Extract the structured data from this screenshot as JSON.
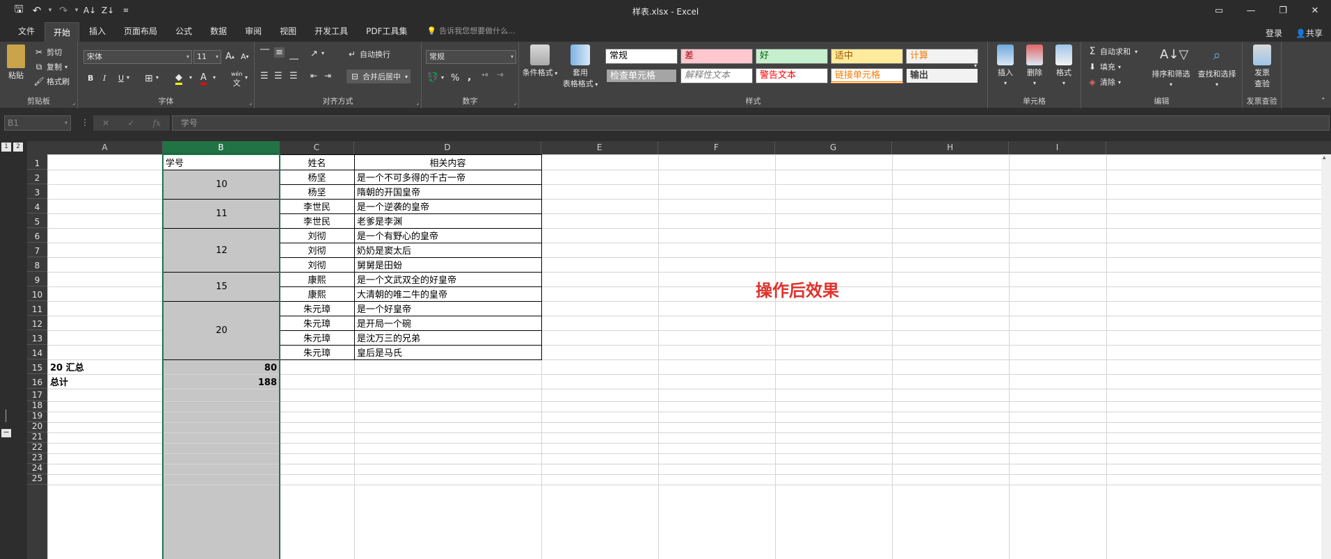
{
  "window": {
    "title": "样表.xlsx - Excel"
  },
  "qat": {
    "save_icon": "save-icon",
    "undo_icon": "undo-icon",
    "redo_icon": "redo-icon",
    "sort_asc_icon": "sort-asc-icon",
    "sort_desc_icon": "sort-desc-icon",
    "customize_icon": "customize-icon"
  },
  "tabs": [
    "文件",
    "开始",
    "插入",
    "页面布局",
    "公式",
    "数据",
    "审阅",
    "视图",
    "开发工具",
    "PDF工具集"
  ],
  "active_tab": "开始",
  "tellme": "告诉我您想要做什么...",
  "login": "登录",
  "share": "共享",
  "ribbon": {
    "clipboard": {
      "label": "剪贴板",
      "paste": "粘贴",
      "cut": "剪切",
      "copy": "复制",
      "format_painter": "格式刷"
    },
    "font": {
      "label": "字体",
      "name": "宋体",
      "size": "11",
      "grow": "A",
      "shrink": "A",
      "bold": "B",
      "italic": "I",
      "underline": "U",
      "color_a": "A",
      "wen": "wén"
    },
    "alignment": {
      "label": "对齐方式",
      "wrap": "自动换行",
      "merge": "合并后居中"
    },
    "number": {
      "label": "数字",
      "format": "常规",
      "percent": "%",
      "comma": ","
    },
    "styles": {
      "label": "样式",
      "cond_format": "条件格式",
      "table_format_1": "套用",
      "table_format_2": "表格格式",
      "cells": [
        {
          "text": "常规",
          "bg": "#ffffff",
          "color": "#000000"
        },
        {
          "text": "差",
          "bg": "#ffc7ce",
          "color": "#9c0006"
        },
        {
          "text": "好",
          "bg": "#c6efce",
          "color": "#006100"
        },
        {
          "text": "适中",
          "bg": "#ffeb9c",
          "color": "#9c5700"
        },
        {
          "text": "计算",
          "bg": "#f2f2f2",
          "color": "#fa7d00"
        },
        {
          "text": "检查单元格",
          "bg": "#a5a5a5",
          "color": "#ffffff"
        },
        {
          "text": "解释性文本",
          "bg": "#ffffff",
          "color": "#7f7f7f"
        },
        {
          "text": "警告文本",
          "bg": "#ffffff",
          "color": "#ff0000"
        },
        {
          "text": "链接单元格",
          "bg": "#ffffff",
          "color": "#fa7d00"
        },
        {
          "text": "输出",
          "bg": "#f2f2f2",
          "color": "#3f3f3f"
        }
      ]
    },
    "cells_group": {
      "label": "单元格",
      "insert": "插入",
      "delete": "删除",
      "format": "格式"
    },
    "editing": {
      "label": "编辑",
      "autosum": "自动求和",
      "fill": "填充",
      "clear": "清除",
      "sort": "排序和筛选",
      "find": "查找和选择"
    },
    "invoice": {
      "label": "发票查验",
      "btn1": "发票",
      "btn2": "查验"
    }
  },
  "formula_bar": {
    "name_box": "B1",
    "cancel": "✕",
    "enter": "✓",
    "fx": "fx",
    "content": "学号"
  },
  "outline": {
    "level1": "1",
    "level2": "2",
    "collapse": "−"
  },
  "columns": [
    "A",
    "B",
    "C",
    "D",
    "E",
    "F",
    "G",
    "H",
    "I"
  ],
  "rows": [
    "1",
    "2",
    "3",
    "4",
    "5",
    "6",
    "7",
    "8",
    "9",
    "10",
    "11",
    "12",
    "13",
    "14",
    "15",
    "16",
    "17",
    "18",
    "19",
    "20",
    "21",
    "22",
    "23",
    "24",
    "25"
  ],
  "cells": {
    "B1": "学号",
    "C1": "姓名",
    "D1": "相关内容",
    "B2_3": "10",
    "B4_5": "11",
    "B6_8": "12",
    "B9_10": "15",
    "B11_14": "20",
    "C2": "杨坚",
    "D2": "是一个不可多得的千古一帝",
    "C3": "杨坚",
    "D3": "隋朝的开国皇帝",
    "C4": "李世民",
    "D4": "是一个逆袭的皇帝",
    "C5": "李世民",
    "D5": "老爹是李渊",
    "C6": "刘彻",
    "D6": "是一个有野心的皇帝",
    "C7": "刘彻",
    "D7": "奶奶是窦太后",
    "C8": "刘彻",
    "D8": "舅舅是田蚡",
    "C9": "康熙",
    "D9": "是一个文武双全的好皇帝",
    "C10": "康熙",
    "D10": "大清朝的唯二牛的皇帝",
    "C11": "朱元璋",
    "D11": "是一个好皇帝",
    "C12": "朱元璋",
    "D12": "是开局一个碗",
    "C13": "朱元璋",
    "D13": "是沈万三的兄弟",
    "C14": "朱元璋",
    "D14": "皇后是马氏",
    "A15": "20 汇总",
    "B15": "80",
    "A16": "总计",
    "B16": "188"
  },
  "annotation": "操作后效果",
  "colors": {
    "excel_green": "#217346",
    "annotation_red": "#e0312b"
  }
}
